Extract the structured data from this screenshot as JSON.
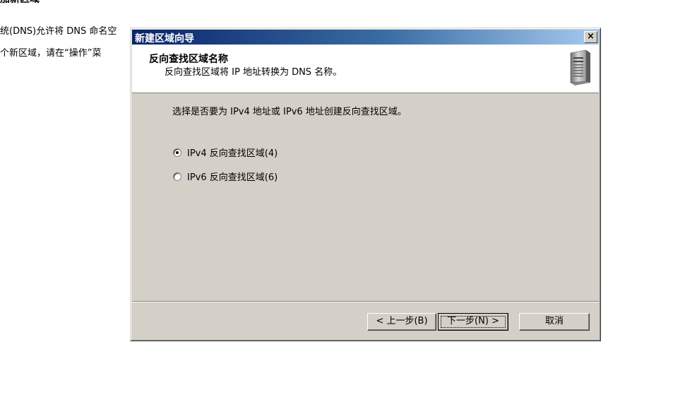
{
  "background": {
    "heading": "添加新区域",
    "line1": "统(DNS)允许将 DNS 命名空",
    "line2": "个新区域，请在“操作”菜"
  },
  "dialog": {
    "title": "新建区域向导",
    "close_label": "×",
    "header_title": "反向查找区域名称",
    "header_subtitle": "反向查找区域将 IP 地址转换为 DNS 名称。",
    "prompt": "选择是否要为 IPv4 地址或 IPv6 地址创建反向查找区域。",
    "options": [
      {
        "label": "IPv4 反向查找区域(4)",
        "checked": true
      },
      {
        "label": "IPv6 反向查找区域(6)",
        "checked": false
      }
    ],
    "buttons": {
      "back": "< 上一步(B)",
      "next": "下一步(N) >",
      "cancel": "取消"
    },
    "icon": "server-icon"
  },
  "colors": {
    "dialog_bg": "#d4d0c8",
    "titlebar_start": "#0a246a",
    "titlebar_end": "#a6caf0"
  }
}
